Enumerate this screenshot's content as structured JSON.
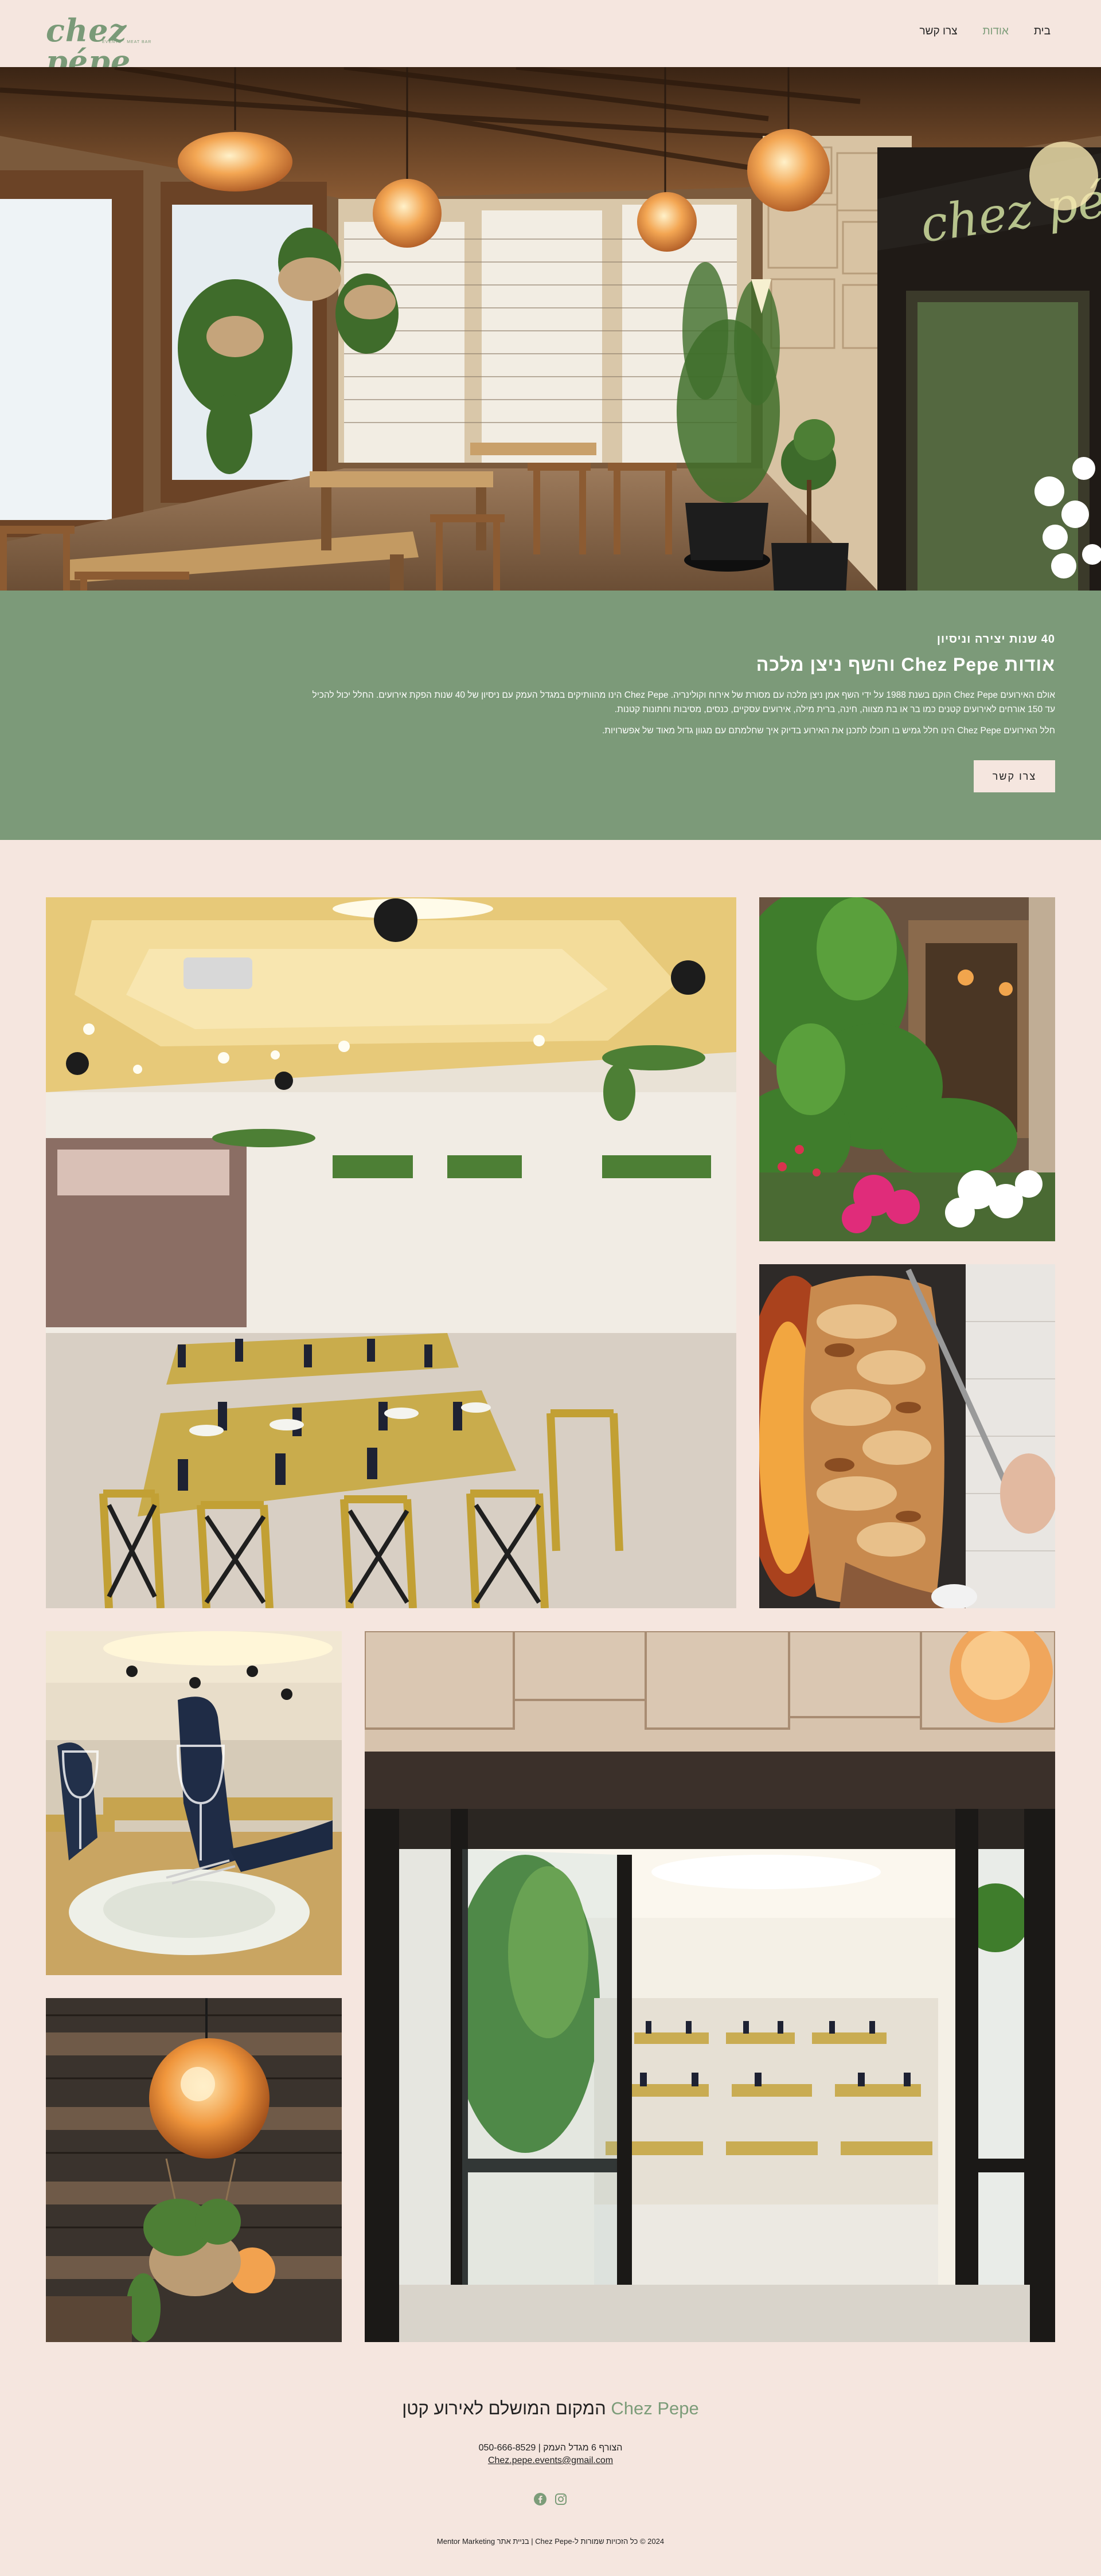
{
  "header": {
    "logo_text": "chez pépe",
    "logo_tagline": "EVENTS · MEAT BAR",
    "nav": [
      {
        "label": "בית",
        "active": false
      },
      {
        "label": "אודות",
        "active": true
      },
      {
        "label": "צרו קשר",
        "active": false
      }
    ]
  },
  "hero": {
    "sign_text": "chez pépe",
    "image_label": "restaurant-interior-photo"
  },
  "about": {
    "kicker": "40 שנות יצירה וניסיון",
    "title": "אודות Chez Pepe והשף ניצן מלכה",
    "paragraph1": "אולם האירועים Chez Pepe הוקם בשנת 1988 על ידי השף אמן ניצן מלכה עם מסורת של אירוח וקולינריה. Chez Pepe הינו מהוותיקים במגדל העמק עם ניסיון של 40 שנות הפקת אירועים. החלל יכול להכיל עד 150 אורחים לאירועים קטנים כמו בר או בת מצווה, חינה, ברית מילה, אירועים עסקיים, כנסים, מסיבות וחתונות קטנות.",
    "paragraph2": "חלל האירועים Chez Pepe הינו חלל גמיש בו תוכלו לתכנן את האירוע בדיוק איך שחלמתם עם מגוון גדול מאוד של אפשרויות.",
    "button_label": "צרו קשר"
  },
  "gallery": {
    "images": [
      "event-hall-photo",
      "garden-entrance-photo",
      "shawarma-photo",
      "table-setting-photo",
      "pendant-lamp-photo",
      "hall-entrance-photo"
    ]
  },
  "footer": {
    "brand": "Chez Pepe",
    "title_rest": "המקום המושלם לאירוע קטן",
    "address": "הצורף 6 מגדל העמק | 050-666-8529",
    "email": "Chez.pepe.events@gmail.com",
    "copyright": "2024 © כל הזכויות שמורות ל-Chez Pepe | בניית אתר Mentor Marketing"
  },
  "colors": {
    "background": "#f5e6df",
    "accent_green": "#7c9a79",
    "text": "#222222"
  }
}
